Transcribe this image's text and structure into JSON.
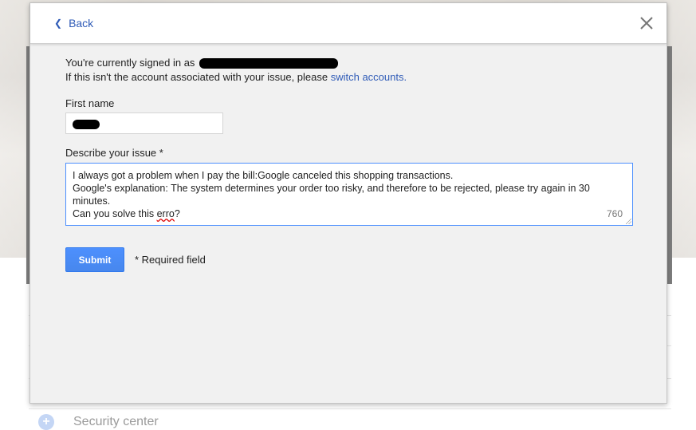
{
  "background": {
    "security_label": "Security center"
  },
  "modal": {
    "back_label": "Back",
    "signed_in_prefix": "You're currently signed in as ",
    "account_line_prefix": "If this isn't the account associated with your issue, please ",
    "switch_accounts_link": "switch accounts.",
    "first_name_label": "First name",
    "describe_label": "Describe your issue *",
    "issue_lines": [
      "I always got a problem when I pay the bill:Google canceled this shopping transactions.",
      "Google's explanation: The system determines your order too risky, and therefore to be rejected, please try again in 30 minutes.",
      "Can you solve this "
    ],
    "issue_misspelled": "erro",
    "issue_end": "?",
    "char_counter": "760",
    "submit_label": "Submit",
    "required_note": "* Required field"
  }
}
